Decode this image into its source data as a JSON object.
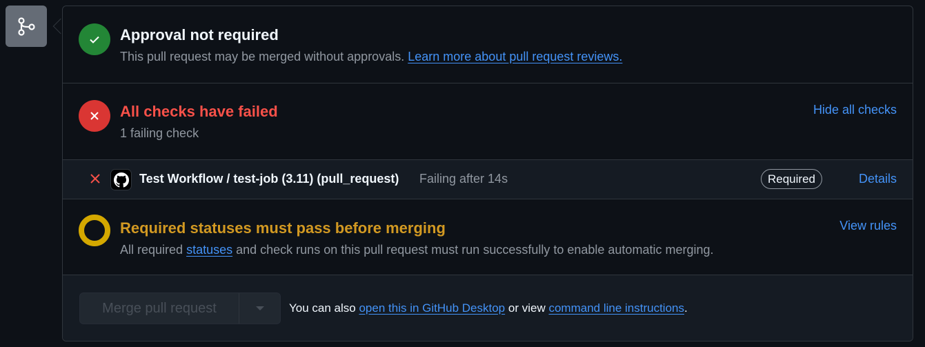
{
  "approval": {
    "title": "Approval not required",
    "text": "This pull request may be merged without approvals.",
    "link": "Learn more about pull request reviews."
  },
  "checks": {
    "title": "All checks have failed",
    "subtitle": "1 failing check",
    "toggle": "Hide all checks"
  },
  "check_row": {
    "name": "Test Workflow / test-job (3.11) (pull_request)",
    "status": "Failing after 14s",
    "badge": "Required",
    "details": "Details"
  },
  "required": {
    "title": "Required statuses must pass before merging",
    "text_before": "All required",
    "link": "statuses",
    "text_after": "and check runs on this pull request must run successfully to enable automatic merging.",
    "rules": "View rules"
  },
  "merge": {
    "button": "Merge pull request",
    "also_prefix": "You can also",
    "desktop_link": "open this in GitHub Desktop",
    "or_view": "or view",
    "cli_link": "command line instructions",
    "suffix": "."
  },
  "colors": {
    "success": "#238636",
    "danger": "#da3633",
    "warning": "#d29922",
    "link": "#4493f8"
  }
}
